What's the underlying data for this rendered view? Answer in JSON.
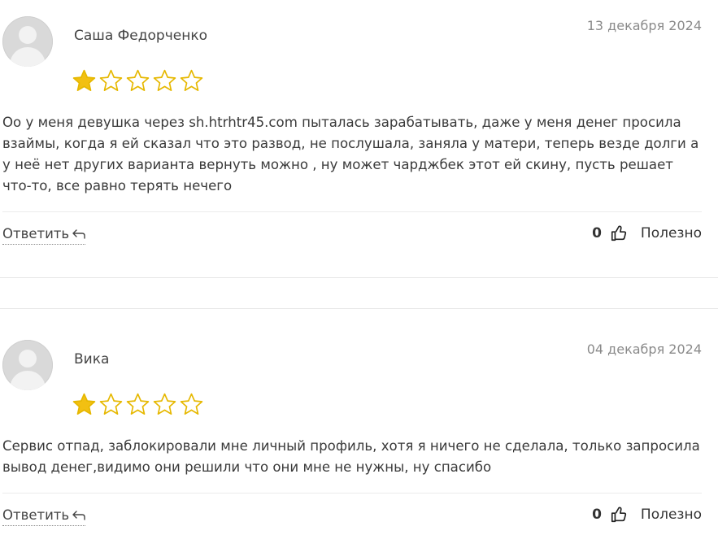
{
  "reviews": [
    {
      "author": "Саша Федорченко",
      "date": "13 декабря 2024",
      "rating": 1,
      "rating_max": 5,
      "text": "Оо у меня девушка через sh.htrhtr45.com пыталась зарабатывать, даже у меня денег просила взаймы, когда я ей сказал что это развод, не послушала, заняла у матери, теперь везде долги а у неё нет других варианта вернуть можно , ну может чарджбек этот ей скину, пусть решает что-то, все равно терять нечего",
      "reply_label": "Ответить",
      "useful_count": "0",
      "useful_label": "Полезно"
    },
    {
      "author": "Вика",
      "date": "04 декабря 2024",
      "rating": 1,
      "rating_max": 5,
      "text": "Сервис отпад, заблокировали мне личный профиль, хотя я ничего не сделала, только запросила вывод денег,видимо они решили что они мне не нужны, ну спасибо",
      "reply_label": "Ответить",
      "useful_count": "0",
      "useful_label": "Полезно"
    }
  ],
  "colors": {
    "star_filled": "#f2c012",
    "star_outline": "#e6b800",
    "text": "#3a3a3a",
    "date": "#8a8a8a"
  },
  "icons": {
    "reply": "reply-arrow-icon",
    "like": "thumbs-up-icon",
    "avatar": "default-avatar-icon",
    "star": "star-icon"
  }
}
